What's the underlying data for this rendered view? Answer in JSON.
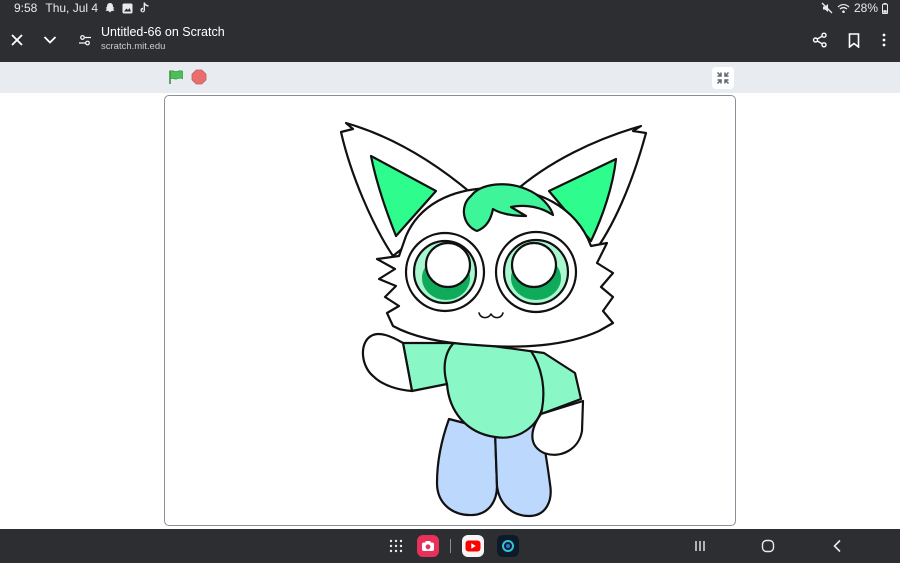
{
  "status_bar": {
    "time": "9:58",
    "date": "Thu, Jul 4",
    "notification_icons": [
      "snapchat-icon",
      "gallery-icon",
      "tiktok-icon"
    ],
    "system_icons": [
      "mute-icon",
      "wifi-icon",
      "battery-icon"
    ],
    "battery": "28%"
  },
  "browser": {
    "page_title": "Untitled-66 on Scratch",
    "url": "scratch.mit.edu",
    "left_icons": [
      "close-icon",
      "chevron-down-icon",
      "site-settings-icon"
    ],
    "right_icons": [
      "share-icon",
      "bookmark-icon",
      "more-icon"
    ]
  },
  "scratch": {
    "controls": [
      "green-flag-icon",
      "stop-icon"
    ],
    "fullscreen_icon": "exit-fullscreen-icon",
    "sprite": "green cat character",
    "colors": {
      "ear_inner": "#2efc8d",
      "hair": "#3ef59a",
      "eye_ring": "#a8f7cf",
      "eye_dark": "#0faa5a",
      "shirt": "#8af8c6",
      "pants": "#bcd8fc",
      "flag": "#4cbf56",
      "stop": "#ec5959"
    }
  },
  "nav_bar": {
    "apps": [
      "apps-grid-icon",
      "camera-app-icon",
      "youtube-app-icon",
      "game-app-icon"
    ],
    "buttons": [
      "recents-icon",
      "home-icon",
      "back-icon"
    ]
  },
  "colors": {
    "chrome_bg": "#2d2e31",
    "controls_bg": "#e8ecf1",
    "stage_border": "#8a9099"
  }
}
